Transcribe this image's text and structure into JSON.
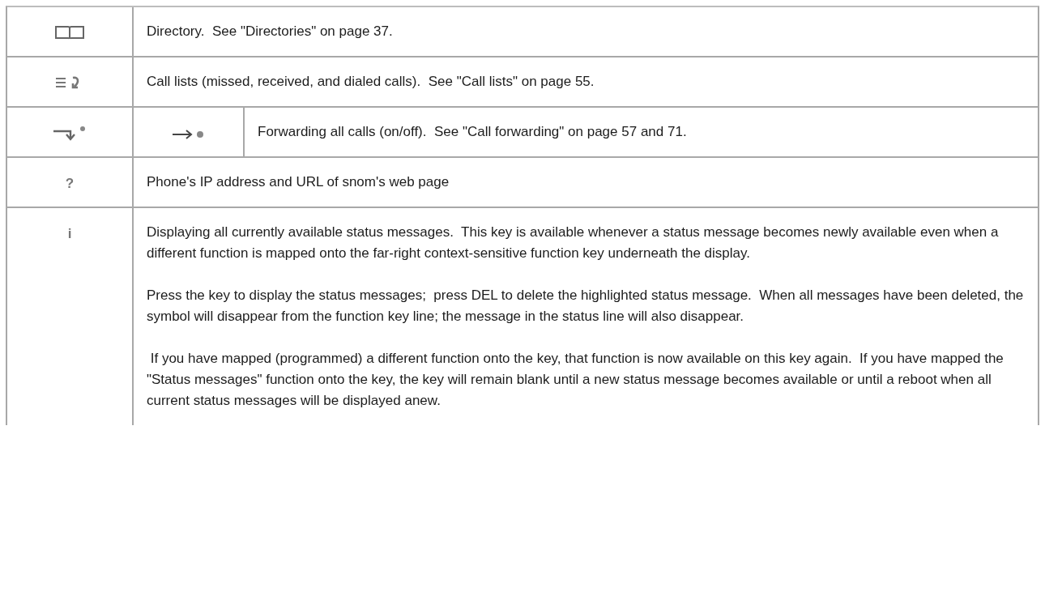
{
  "table": {
    "rows": [
      {
        "icon": {
          "kind": "book"
        },
        "paragraphs": [
          "Directory.  See \"Directories\" on page 37."
        ]
      },
      {
        "icon": {
          "kind": "list-arrow"
        },
        "paragraphs": [
          "Call lists (missed, received, and dialed calls).  See \"Call lists\" on page 55."
        ]
      },
      {
        "icon": {
          "kind": "hook-arrow-dot"
        },
        "column_2_icon": {
          "kind": "arrow-dot"
        },
        "paragraphs": [
          "Forwarding all calls (on/off).  See \"Call forwarding\" on page 57 and 71."
        ]
      },
      {
        "icon": {
          "kind": "glyph",
          "text": "?"
        },
        "paragraphs": [
          "Phone's IP address and URL of snom's web page"
        ]
      },
      {
        "icon": {
          "kind": "glyph",
          "text": "i"
        },
        "paragraphs": [
          "Displaying all currently available status messages.  This key is available whenever a status message becomes newly available even when a different function is mapped onto the far-right context-sensitive function key underneath the display.",
          "Press the key to display the status messages;  press DEL to delete the highlighted status message.  When all messages have been deleted, the symbol will disappear from the function key line; the message in the status line will also disappear.",
          " If you have mapped (programmed) a different function onto the key, that function is now available on this key again.  If you have mapped the \"Status messages\" function onto the key, the key will remain blank until a new status message becomes available or until a reboot when all current status messages will be displayed anew."
        ]
      }
    ]
  }
}
